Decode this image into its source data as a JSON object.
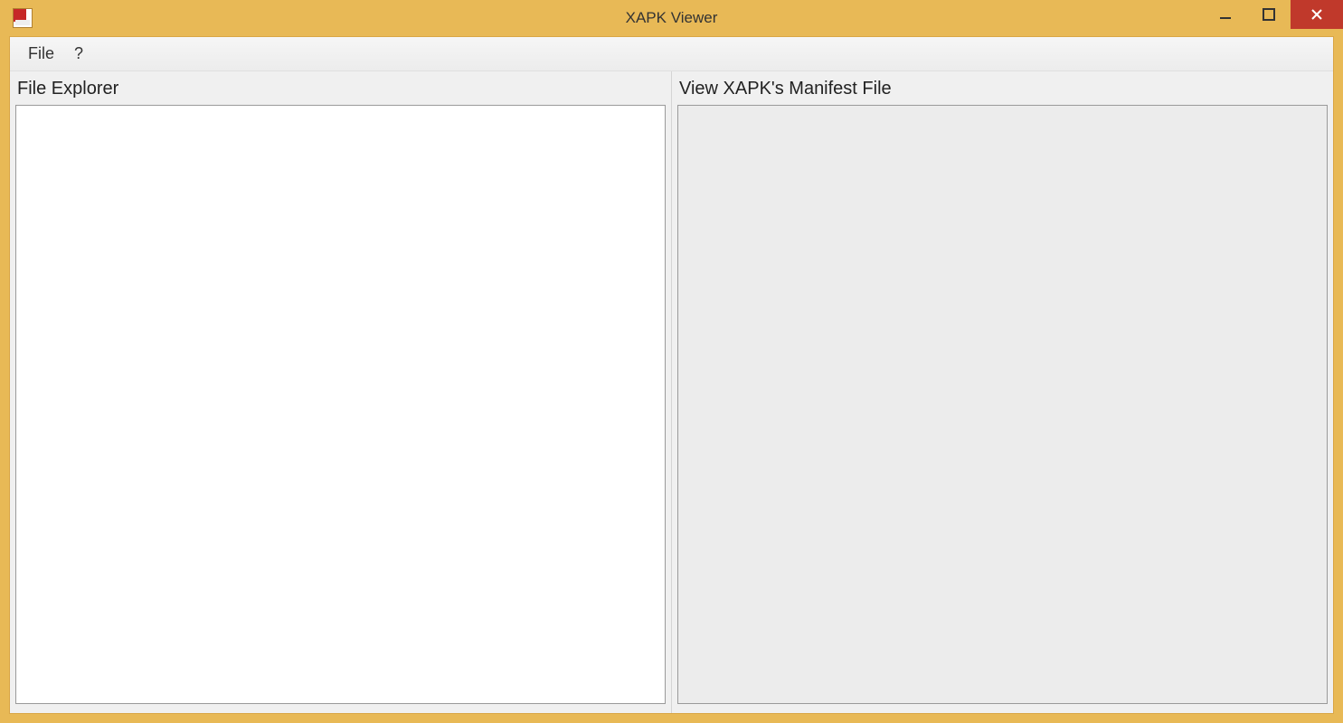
{
  "window": {
    "title": "XAPK Viewer"
  },
  "menubar": {
    "items": [
      {
        "label": "File"
      },
      {
        "label": "?"
      }
    ]
  },
  "panels": {
    "left": {
      "heading": "File Explorer"
    },
    "right": {
      "heading": "View XAPK's Manifest File"
    }
  }
}
